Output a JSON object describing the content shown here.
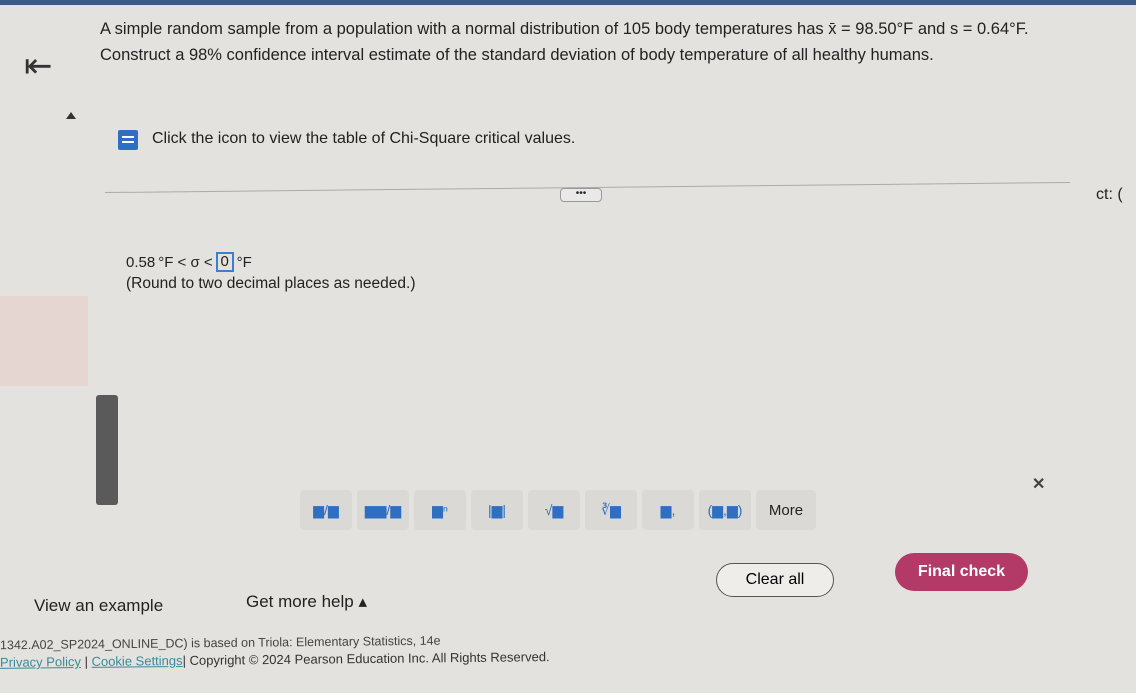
{
  "question": {
    "text1": "A simple random sample from a population with a normal distribution of 105 body temperatures has ",
    "xbar": "x̄ = 98.50°F",
    "text2": " and ",
    "s": "s = 0.64°F",
    "text3": ". Construct a 98% confidence interval estimate of the standard deviation of body temperature of all healthy humans."
  },
  "table_link": "Click the icon to view the table of Chi-Square critical values.",
  "more_dots": "•••",
  "cut_text": "ct: (",
  "answer": {
    "lower": "0.58",
    "unit1": "°F < σ <",
    "upper_value": "0",
    "unit2": "°F"
  },
  "note": "(Round to two decimal places as needed.)",
  "palette": [
    "▆/▆",
    "▆▆/▆",
    "▆ⁿ",
    "|▆|",
    "√▆",
    "∛▆",
    "▆,",
    "(▆,▆)",
    "More"
  ],
  "buttons": {
    "clear": "Clear all",
    "final": "Final check",
    "view_example": "View an example",
    "get_help": "Get more help ▴"
  },
  "footer": {
    "line1": "1342.A02_SP2024_ONLINE_DC) is based on Triola: Elementary Statistics, 14e",
    "privacy": "Privacy Policy",
    "cookie": "Cookie Settings",
    "copyright": "| Copyright © 2024 Pearson Education Inc. All Rights Reserved."
  },
  "colors": {
    "accent": "#2f6fc1",
    "final_check": "#b33a66"
  }
}
